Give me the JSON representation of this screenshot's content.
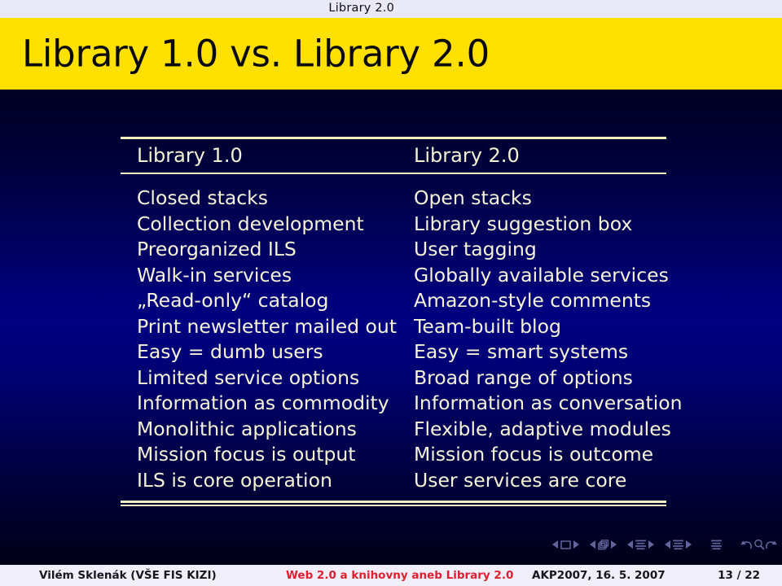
{
  "headbar": {
    "text": "Library 2.0"
  },
  "title": {
    "text": "Library 1.0 vs. Library 2.0"
  },
  "table": {
    "headers": [
      "Library 1.0",
      "Library 2.0"
    ],
    "rows": [
      [
        "Closed stacks",
        "Open stacks"
      ],
      [
        "Collection development",
        "Library suggestion box"
      ],
      [
        "Preorganized ILS",
        "User tagging"
      ],
      [
        "Walk-in services",
        "Globally available services"
      ],
      [
        "„Read-only“ catalog",
        "Amazon-style comments"
      ],
      [
        "Print newsletter mailed out",
        "Team-built blog"
      ],
      [
        "Easy = dumb users",
        "Easy = smart systems"
      ],
      [
        "Limited service options",
        "Broad range of options"
      ],
      [
        "Information as commodity",
        "Information as conversation"
      ],
      [
        "Monolithic applications",
        "Flexible, adaptive modules"
      ],
      [
        "Mission focus is output",
        "Mission focus is outcome"
      ],
      [
        "ILS is core operation",
        "User services are core"
      ]
    ]
  },
  "navigation": {
    "icons": [
      "previous-slide-icon",
      "slide-icon",
      "next-slide-icon",
      "previous-frame-icon",
      "frames-icon",
      "next-frame-icon",
      "previous-subsection-icon",
      "subsection-icon",
      "next-subsection-icon",
      "previous-section-icon",
      "section-icon",
      "next-section-icon",
      "document-icon",
      "back-icon",
      "search-icon",
      "forward-icon"
    ]
  },
  "footer": {
    "author": "Vilém Sklenák  (VŠE FIS KIZI)",
    "talk": "Web 2.0 a knihovny aneb Library 2.0",
    "event": "AKP2007, 16. 5. 2007",
    "page": "13 / 22"
  },
  "colors": {
    "title_band": "#ffe000",
    "head_bar": "#e9e9f7",
    "body_blue": "#000080",
    "rule": "#f2efc0",
    "text_cream": "#f7f3d6",
    "footer_accent": "#e02030"
  }
}
